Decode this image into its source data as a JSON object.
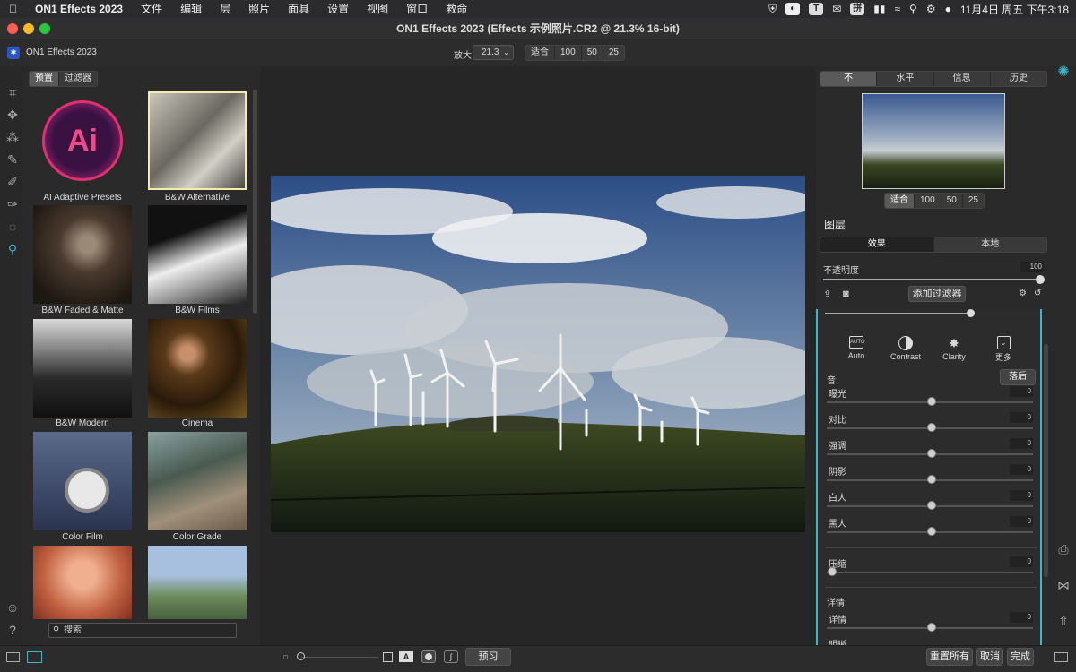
{
  "menubar": {
    "app_name": "ON1 Effects 2023",
    "items": [
      "文件",
      "编辑",
      "层",
      "照片",
      "面具",
      "设置",
      "视图",
      "窗口",
      "救命"
    ],
    "clock": "11月4日 周五 下午3:18"
  },
  "window": {
    "title": "ON1 Effects 2023 (Effects 示例照片.CR2 @ 21.3% 16-bit)",
    "app_label": "ON1 Effects 2023"
  },
  "toolbar": {
    "zoom_label": "放大",
    "zoom_value": "21.3",
    "zoom_options": [
      "适合",
      "100",
      "50",
      "25"
    ]
  },
  "browser": {
    "tabs": [
      "预置",
      "过滤器"
    ],
    "presets": [
      "AI Adaptive Presets",
      "B&W Alternative",
      "B&W Faded & Matte",
      "B&W Films",
      "B&W Modern",
      "Cinema",
      "Color Film",
      "Color Grade"
    ],
    "ai_logo_text": "Ai",
    "search_placeholder": "搜索"
  },
  "right_panel": {
    "tabs": [
      "不",
      "水平",
      "信息",
      "历史"
    ],
    "nav_zoom": [
      "适合",
      "100",
      "50",
      "25"
    ],
    "layers_title": "图层",
    "layer_tabs": [
      "效果",
      "本地"
    ],
    "opacity_label": "不透明度",
    "opacity_value": "100",
    "add_filter": "添加过滤器",
    "tone_tools": [
      "Auto",
      "Contrast",
      "Clarity",
      "更多"
    ],
    "tone_section": "音:",
    "fall_back": "落后",
    "sliders": [
      {
        "label": "曝光",
        "value": "0"
      },
      {
        "label": "对比",
        "value": "0"
      },
      {
        "label": "强调",
        "value": "0"
      },
      {
        "label": "阴影",
        "value": "0"
      },
      {
        "label": "白人",
        "value": "0"
      },
      {
        "label": "黑人",
        "value": "0"
      }
    ],
    "compress": {
      "label": "压缩",
      "value": "0"
    },
    "detail_section": "详情:",
    "detail": {
      "label": "详情",
      "value": "0"
    },
    "next_label": "明晰"
  },
  "bottom": {
    "preview": "预习",
    "reset_all": "重置所有",
    "cancel": "取消",
    "done": "完成"
  },
  "colors": {
    "accent_teal": "#3fb6c8",
    "panel_bg": "#2a2a2a"
  }
}
